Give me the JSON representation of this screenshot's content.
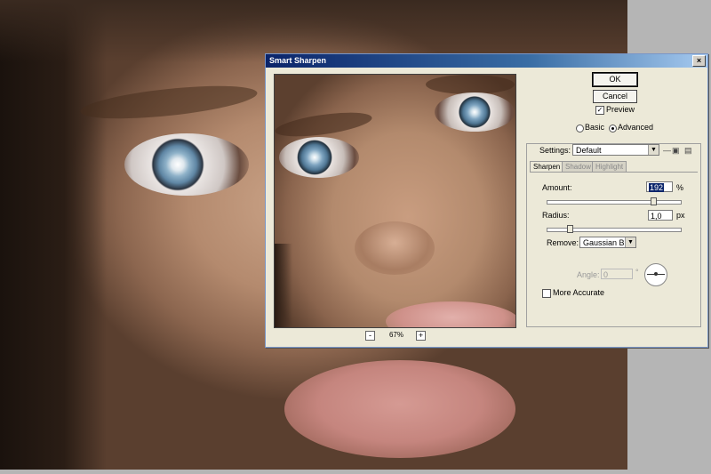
{
  "dialog": {
    "title": "Smart Sharpen",
    "close_glyph": "×",
    "ok_label": "OK",
    "cancel_label": "Cancel",
    "preview_label": "Preview",
    "preview_checked": true,
    "mode_basic": "Basic",
    "mode_advanced": "Advanced",
    "selected_mode": "Advanced",
    "zoom": {
      "minus": "-",
      "value": "67%",
      "plus": "+"
    },
    "settings_label": "Settings:",
    "settings_value": "Default",
    "tabs": [
      {
        "label": "Sharpen"
      },
      {
        "label": "Shadow"
      },
      {
        "label": "Highlight"
      }
    ],
    "active_tab": "Sharpen",
    "amount_label": "Amount:",
    "amount_value": "192",
    "amount_unit": "%",
    "amount_fraction": 0.8,
    "radius_label": "Radius:",
    "radius_value": "1,0",
    "radius_unit": "px",
    "radius_fraction": 0.15,
    "remove_label": "Remove:",
    "remove_value": "Gaussian Blur",
    "angle_label": "Angle:",
    "angle_value": "0",
    "angle_unit": "°",
    "more_accurate_label": "More Accurate",
    "more_accurate_checked": false,
    "check_glyph": "✓",
    "dropdown_glyph": "▼",
    "save_icon_glyph": "▣",
    "delete_icon_glyph": "▤"
  },
  "icons": [
    "close-icon",
    "save-settings-icon",
    "delete-settings-icon",
    "chevron-down-icon",
    "angle-dial-icon"
  ]
}
